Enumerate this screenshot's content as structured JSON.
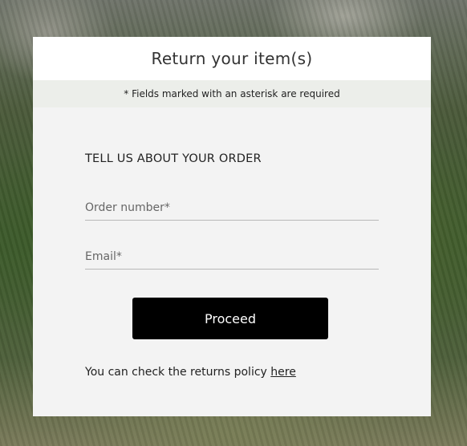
{
  "modal": {
    "title": "Return your item(s)",
    "required_note": "* Fields marked with an asterisk are required"
  },
  "form": {
    "section_heading": "TELL US ABOUT YOUR ORDER",
    "order_number_placeholder": "Order number*",
    "order_number_value": "",
    "email_placeholder": "Email*",
    "email_value": "",
    "proceed_label": "Proceed"
  },
  "policy": {
    "text": "You can check the returns policy ",
    "link_label": "here"
  }
}
